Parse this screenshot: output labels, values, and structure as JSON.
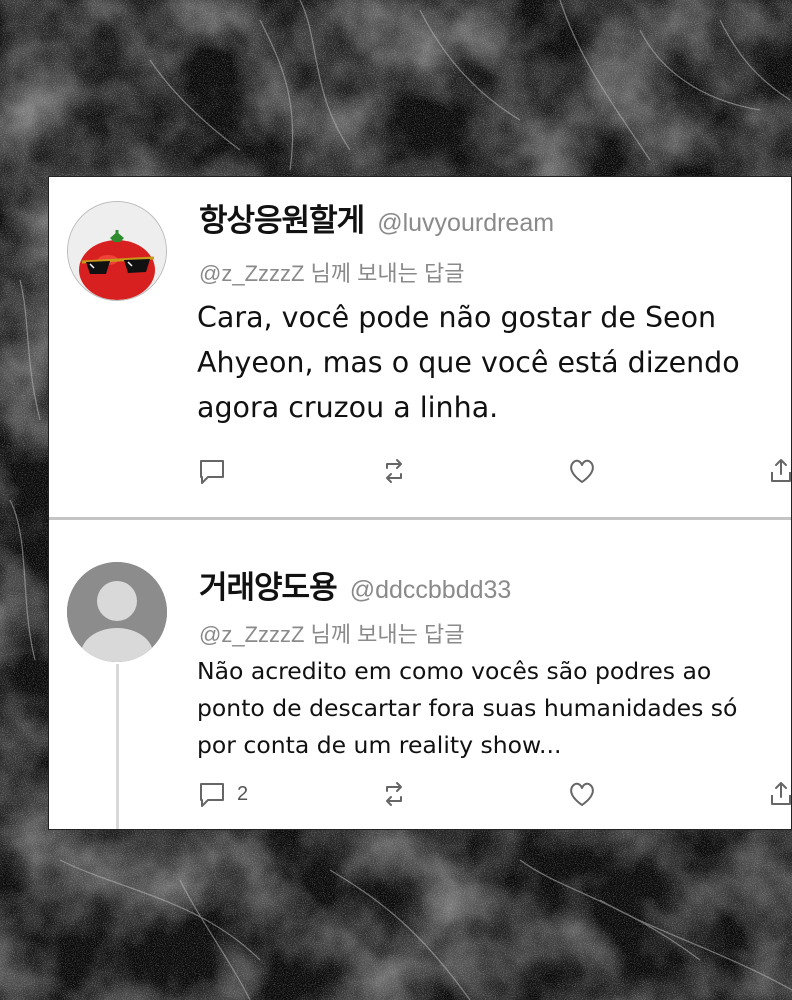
{
  "colors": {
    "card_background": "#ffffff",
    "name_text": "#111111",
    "muted_text": "#8a8a8a",
    "avatar_tomato": "#d92020",
    "avatar_default": "#8c8c8c"
  },
  "tweets": [
    {
      "display_name": "항상응원할게",
      "handle": "@luvyourdream",
      "reply_to": "@z_ZzzzZ 님께 보내는 답글",
      "text": "Cara, você pode não gostar de Seon Ahyeon, mas o que você está dizendo agora cruzou a linha.",
      "avatar_icon": "tomato-sunglasses-avatar",
      "reply_count": ""
    },
    {
      "display_name": "거래양도용",
      "handle": "@ddccbbdd33",
      "reply_to": "@z_ZzzzZ 님께 보내는 답글",
      "text": "Não acredito em como vocês são podres ao ponto de descartar fora suas humanidades só por conta de um reality show...",
      "avatar_icon": "default-user-avatar",
      "reply_count": "2"
    }
  ],
  "action_icons": [
    "reply-icon",
    "retweet-icon",
    "like-icon",
    "share-icon"
  ]
}
